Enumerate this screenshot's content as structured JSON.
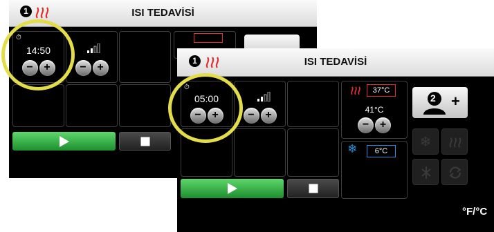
{
  "screen_back": {
    "step_number": "1",
    "title": "ISI TEDAVİSİ",
    "timer": {
      "value": "14:50",
      "minus": "−",
      "plus": "+"
    },
    "power": {
      "minus": "−",
      "plus": "+"
    }
  },
  "screen_front": {
    "step_number": "1",
    "title": "ISI TEDAVİSİ",
    "timer": {
      "value": "05:00",
      "minus": "−",
      "plus": "+"
    },
    "power": {
      "minus": "−",
      "plus": "+"
    },
    "heating": {
      "bath_temp": "37°C",
      "target_temp": "41°C",
      "minus": "−",
      "plus": "+"
    },
    "cooling": {
      "bath_temp": "6°C"
    },
    "user_button": {
      "number": "2",
      "plus": "+"
    },
    "unit_toggle": "°F/°C"
  },
  "colors": {
    "accent_red": "#e13030",
    "accent_blue": "#2f8fd8",
    "play_green": "#2eb83e",
    "highlight_ring": "#e4dd4a"
  },
  "icons": [
    "heat-icon",
    "timer-icon",
    "power-level-icon",
    "snowflake-icon",
    "play-icon",
    "stop-icon",
    "user-add-icon"
  ]
}
